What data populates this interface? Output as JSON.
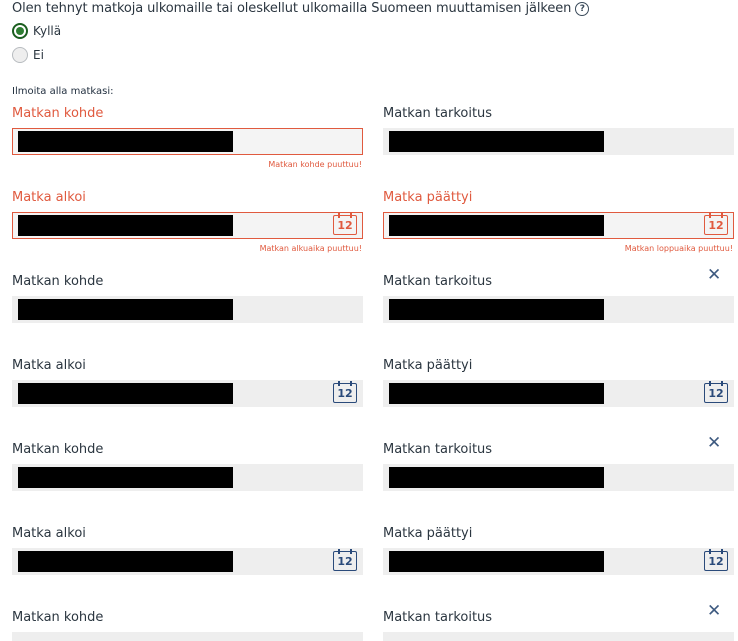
{
  "question": {
    "text": "Olen tehnyt matkoja ulkomaille tai oleskellut ulkomailla Suomeen muuttamisen jälkeen",
    "help_icon": "?"
  },
  "options": [
    {
      "label": "Kyllä",
      "checked": true
    },
    {
      "label": "Ei",
      "checked": false
    }
  ],
  "section_label": "Ilmoita alla matkasi:",
  "labels": {
    "destination": "Matkan kohde",
    "purpose": "Matkan tarkoitus",
    "start": "Matka alkoi",
    "end": "Matka päättyi"
  },
  "errors": {
    "destination_missing": "Matkan kohde puuttuu!",
    "start_missing": "Matkan alkuaika puuttuu!",
    "end_missing": "Matkan loppuaika puuttuu!"
  },
  "calendar_day": "12",
  "close_symbol": "✕",
  "colors": {
    "error": "#e05a3f",
    "accent": "#2e7d32",
    "icon": "#2a4a7a"
  }
}
